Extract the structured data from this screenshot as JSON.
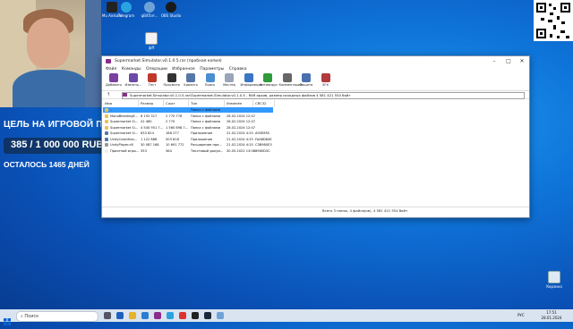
{
  "desktop": {
    "icons": [
      {
        "label": "Mu Ainkam",
        "icon": "app-icon"
      },
      {
        "label": "Telegram",
        "icon": "telegram-icon"
      },
      {
        "label": "qBitTorr...",
        "icon": "qbittorrent-icon"
      },
      {
        "label": "OBS Studio",
        "icon": "obs-icon"
      },
      {
        "label": "фff",
        "icon": "file-icon"
      }
    ],
    "recycle_label": "Корзина"
  },
  "overlay": {
    "goal_title": "ЦЕЛЬ НА ИГРОВОЙ П",
    "goal_amount": "385 / 1 000 000 RUB",
    "goal_days": "ОСТАЛОСЬ 1465 ДНЕЙ"
  },
  "window": {
    "title": "Supermarket.Simulator.v0.1.0.5.rar (пробная копия)",
    "controls": [
      "–",
      "□",
      "✕"
    ],
    "menu": [
      "Файл",
      "Команды",
      "Операции",
      "Избранное",
      "Параметры",
      "Справка"
    ],
    "toolbar": [
      {
        "label": "Добавить",
        "icon": "add-icon",
        "color": "#7a3fa0"
      },
      {
        "label": "Извлечь...",
        "icon": "extract-icon",
        "color": "#6b4aa8"
      },
      {
        "label": "Тест",
        "icon": "test-icon",
        "color": "#c0392b"
      },
      {
        "label": "Просмотр",
        "icon": "view-icon",
        "color": "#333333"
      },
      {
        "label": "Удалить",
        "icon": "delete-icon",
        "color": "#5577aa"
      },
      {
        "label": "Поиск",
        "icon": "find-icon",
        "color": "#4a8fd0"
      },
      {
        "label": "Мастер",
        "icon": "wizard-icon",
        "color": "#9aa6b8"
      },
      {
        "label": "Информация",
        "icon": "info-icon",
        "color": "#3a76c4"
      },
      {
        "label": "Антивирус",
        "icon": "antivirus-icon",
        "color": "#2e9a3a"
      },
      {
        "label": "Комментарий",
        "icon": "comment-icon",
        "color": "#666666"
      },
      {
        "label": "Защита",
        "icon": "protect-icon",
        "color": "#4a70b0"
      },
      {
        "label": "SFX",
        "icon": "sfx-icon",
        "color": "#b23a3a"
      }
    ],
    "address": "Supermarket.Simulator.v0.1.0.5.rar\\Supermarket.Simulator.v0.1.0.5 - RAR архив, размер исходных файлов 4 581 421 554 байт",
    "columns": [
      "Имя",
      "Размер",
      "Сжат",
      "Тип",
      "Изменён",
      "CRC32"
    ],
    "rows": [
      {
        "name": "..",
        "size": "",
        "packed": "",
        "type": "Папка с файлами",
        "modified": "",
        "crc": "",
        "selected": true,
        "icon": "folder-up-icon"
      },
      {
        "name": "MonoBleedingE...",
        "size": "6 192 317",
        "packed": "2 770 776",
        "type": "Папка с файлами",
        "modified": "28.02.2024 12:47",
        "crc": "",
        "selected": false,
        "icon": "folder-icon"
      },
      {
        "name": "Supermarket Si...",
        "size": "41 460",
        "packed": "2 770",
        "type": "Папка с файлами",
        "modified": "28.02.2024 12:47",
        "crc": "",
        "selected": false,
        "icon": "folder-icon"
      },
      {
        "name": "Supermarket Si...",
        "size": "4 540 951 7...",
        "packed": "1 560 898 7...",
        "type": "Папка с файлами",
        "modified": "28.02.2024 12:47",
        "crc": "",
        "selected": false,
        "icon": "folder-icon"
      },
      {
        "name": "Supermarket Si...",
        "size": "633 824",
        "packed": "188 277",
        "type": "Приложение",
        "modified": "21.02.2024 4:25",
        "crc": "A05E8FA",
        "selected": false,
        "icon": "exe-icon"
      },
      {
        "name": "UnityCrashHan...",
        "size": "1 122 888",
        "packed": "503 818",
        "type": "Приложение",
        "modified": "21.02.2024 4:25",
        "crc": "FAA8D84E",
        "selected": false,
        "icon": "exe-icon"
      },
      {
        "name": "UnityPlayer.dll",
        "size": "30 087 168",
        "packed": "10 691 772",
        "type": "Расширение при...",
        "modified": "21.02.2024 4:25",
        "crc": "C3B980E3",
        "selected": false,
        "icon": "dll-icon"
      },
      {
        "name": "Приятной игры...",
        "size": "353",
        "packed": "364",
        "type": "Текстовый докум...",
        "modified": "30.05.2022 13:08",
        "crc": "8960D3C",
        "selected": false,
        "icon": "txt-icon"
      }
    ],
    "status": "Всего 3 папок, 4 файла(ов), 4 581 421 554 байт"
  },
  "taskbar": {
    "search_placeholder": "Поиск",
    "lang": "РУС",
    "time": "17:51",
    "date": "28.01.2024"
  }
}
